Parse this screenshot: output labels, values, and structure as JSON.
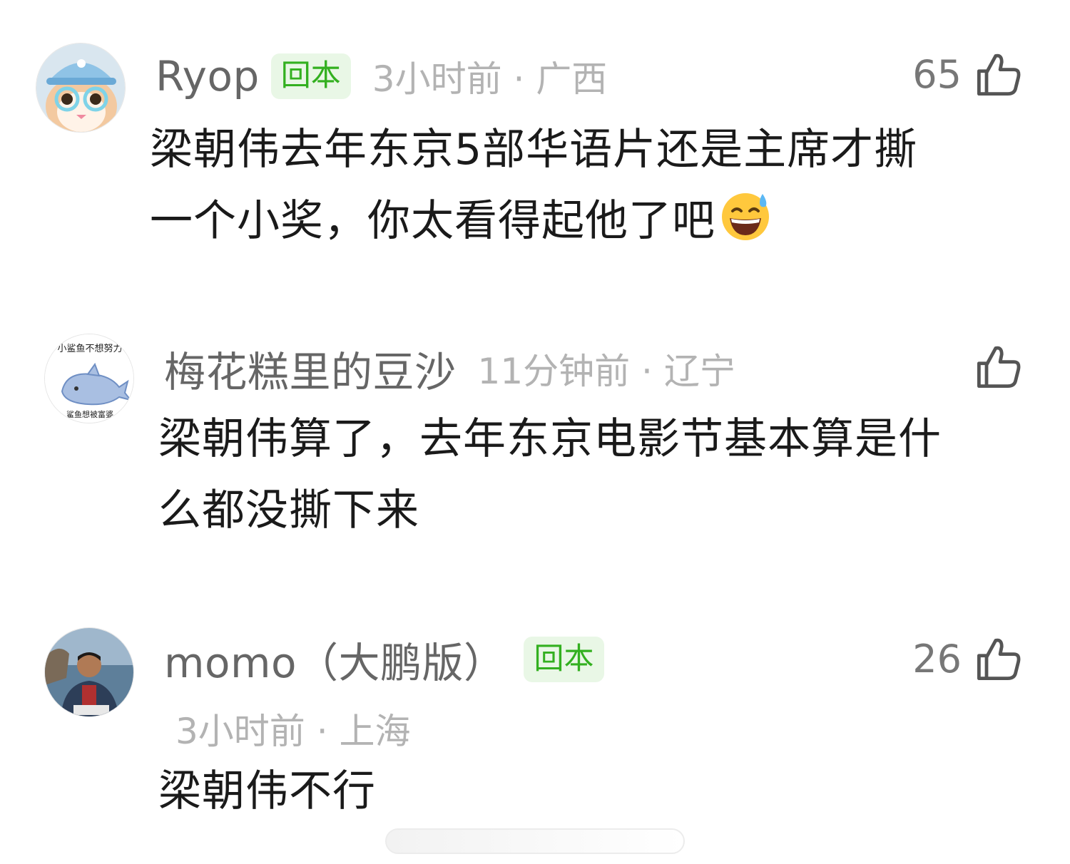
{
  "comments": [
    {
      "username": "Ryop",
      "badge": "回本",
      "time_location": "3小时前 · 广西",
      "likes": "65",
      "text_line1": "梁朝伟去年东京5部华语片还是主席才撕",
      "text_line2": "一个小奖，你太看得起他了吧",
      "emoji": "grinning-sweat-emoji",
      "avatar": "cat-with-hat-avatar"
    },
    {
      "username": "梅花糕里的豆沙",
      "time_location": "11分钟前 · 辽宁",
      "likes": "",
      "text_line1": "梁朝伟算了，去年东京电影节基本算是什",
      "text_line2": "么都没撕下来",
      "avatar": "whale-sticker-avatar",
      "avatar_text_top": "小鲨鱼不想努力",
      "avatar_text_bottom": "鲨鱼想被富婆"
    },
    {
      "username": "momo（大鹏版）",
      "badge": "回本",
      "time_location": "3小时前 · 上海",
      "likes": "26",
      "text_line1": "梁朝伟不行",
      "avatar": "man-photo-avatar"
    }
  ],
  "icons": {
    "like": "thumbs-up-icon"
  },
  "colors": {
    "badge_text": "#33b020",
    "badge_bg": "#e9f7e6",
    "meta_gray": "#b3b3b3",
    "username_gray": "#666666"
  }
}
